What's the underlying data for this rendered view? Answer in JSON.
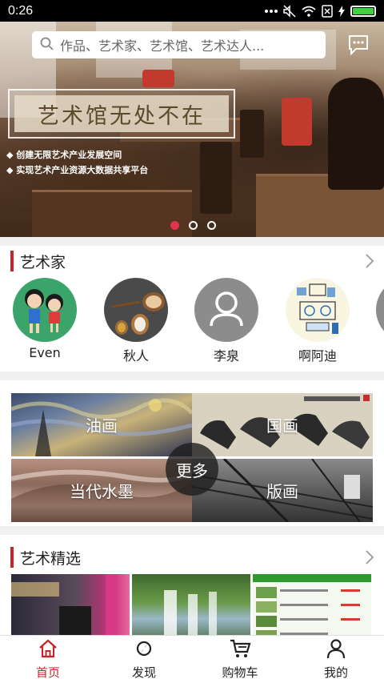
{
  "status": {
    "time": "0:26"
  },
  "search": {
    "placeholder": "作品、艺术家、艺术馆、艺术达人..."
  },
  "banner": {
    "slogan": "艺术馆无处不在",
    "bullets": [
      "◆ 创建无限艺术产业发展空间",
      "◆ 实现艺术产业资源大数据共享平台"
    ],
    "dot_count": 3,
    "active_dot": 0
  },
  "artists_section": {
    "title": "艺术家",
    "items": [
      {
        "name": "Even",
        "avatar": "cartoon-kids"
      },
      {
        "name": "秋人",
        "avatar": "spice-spoons"
      },
      {
        "name": "李泉",
        "avatar": "default-user"
      },
      {
        "name": "啊阿迪",
        "avatar": "machine-drawing"
      }
    ]
  },
  "categories": {
    "items": [
      "油画",
      "国画",
      "当代水墨",
      "版画"
    ],
    "more": "更多"
  },
  "featured_section": {
    "title": "艺术精选"
  },
  "tabbar": {
    "tabs": [
      {
        "label": "首页",
        "icon": "home-icon",
        "active": true
      },
      {
        "label": "发现",
        "icon": "compass-icon",
        "active": false
      },
      {
        "label": "购物车",
        "icon": "cart-icon",
        "active": false
      },
      {
        "label": "我的",
        "icon": "user-icon",
        "active": false
      }
    ]
  },
  "colors": {
    "accent": "#c8242c",
    "active_dot": "#e0344c",
    "battery": "#3cd43c"
  }
}
